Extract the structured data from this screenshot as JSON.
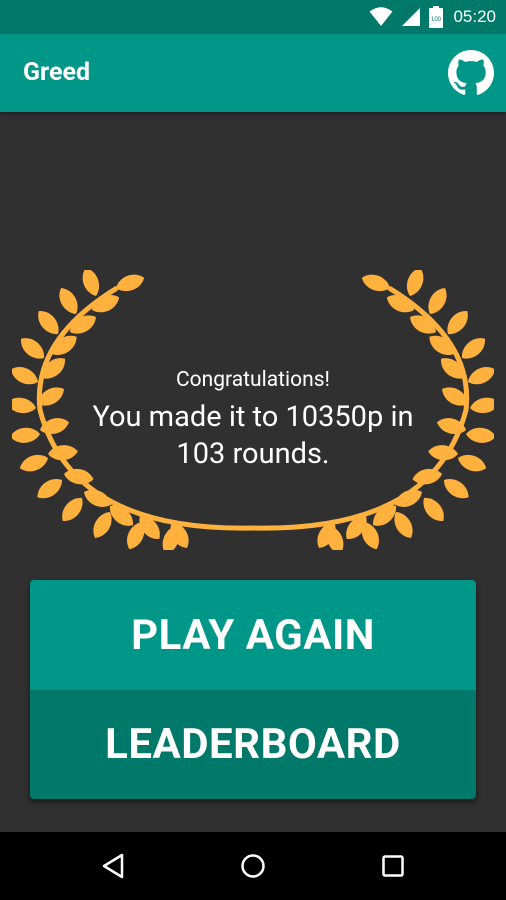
{
  "status_bar": {
    "time": "05:20",
    "battery_level": "100",
    "icons": [
      "wifi-icon",
      "cell-signal-icon",
      "battery-icon"
    ]
  },
  "app_bar": {
    "title": "Greed",
    "action_icon": "github-icon"
  },
  "result": {
    "congrats": "Congratulations!",
    "line1": "You made it to 10350p in",
    "line2": "103 rounds."
  },
  "buttons": {
    "play_again": "PLAY AGAIN",
    "leaderboard": "LEADERBOARD"
  },
  "nav_bar": {
    "icons": [
      "back-icon",
      "home-icon",
      "recents-icon"
    ]
  },
  "colors": {
    "primary": "#009688",
    "primary_dark": "#00796B",
    "background": "#303030",
    "laurel": "#FFB13D"
  }
}
